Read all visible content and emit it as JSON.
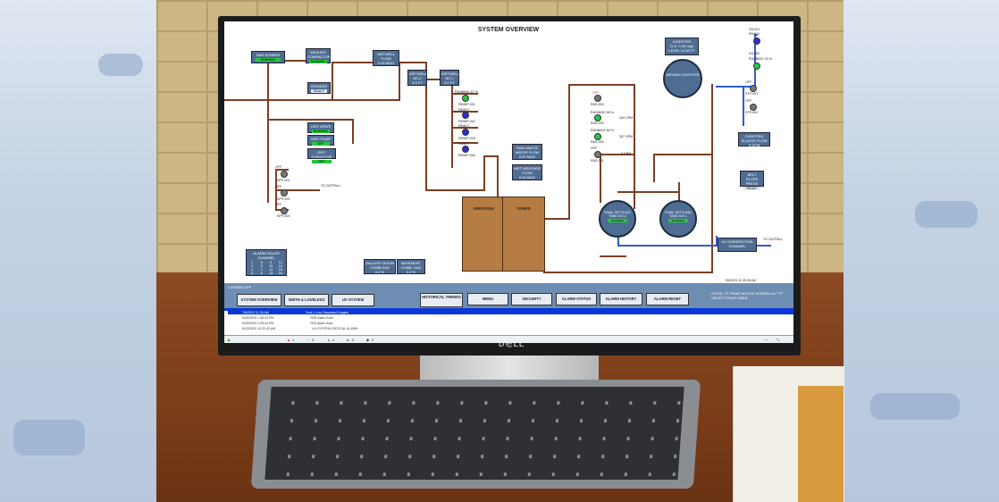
{
  "title": "SYSTEM OVERVIEW",
  "equipment": {
    "bar_screen": {
      "label": "BAR SCREEN",
      "status": "RUNNING"
    },
    "washer_compactor": {
      "label": "WASHER COMPACTOR",
      "status": "RUNNING"
    },
    "grinder": {
      "label": "GRINDER",
      "status": "READY"
    },
    "grit_drive": {
      "label": "GRIT DRIVE",
      "status": "RUNNING"
    },
    "grit_pump": {
      "label": "GRIT PUMP",
      "status": "OFF"
    },
    "grit_conveyor": {
      "label": "GRIT CONVEYOR",
      "status": "OFF"
    },
    "wetwell_flow": {
      "label": "WETWELL FLOW",
      "value": "0.45 MGD"
    },
    "wetwell_2": {
      "label": "WETWELL NO.2",
      "value": "4.3 FT"
    },
    "wetwell_1": {
      "label": "WETWELL NO.1",
      "value": "4.0 FT"
    },
    "raw_waste": {
      "label": "RAW WASTE WATER FLOW",
      "value": "0.57 MGD"
    },
    "wet_weather": {
      "label": "WET WEATHER FLOW",
      "value": "0.00 MGD"
    },
    "digester": {
      "label": "DIGESTER",
      "do": "D.O.   0.25 mg/l",
      "level": "LEVEL   14.56 FT"
    },
    "aerobic_digester": {
      "label": "AEROBIC DIGESTER"
    },
    "digested_sludge": {
      "label": "DIGESTED SLUDGE FLOW",
      "value": "0 GPM"
    },
    "belt_filter": {
      "label": "BELT FILTER PRESS",
      "status": "READY"
    },
    "uv": {
      "label": "UV DISINFECTION CHANNEL"
    },
    "fst2": {
      "label": "FINAL SETTLING TANK NO.2",
      "status": "RUNNING"
    },
    "fst1": {
      "label": "FINAL SETTLING TANK NO.1",
      "status": "RUNNING"
    },
    "gallery": {
      "label": "GALLERY ROOM COMB.GAS",
      "value": "0.2 %"
    },
    "basement": {
      "label": "BASEMENT COMB. GAS",
      "value": "0.2 %"
    },
    "aeration": {
      "label": "AERATION"
    },
    "tanks": {
      "label": "TANKS"
    }
  },
  "pumps": {
    "rwwp1": {
      "label": "RWWP-001",
      "status": "RUNNING 67 %"
    },
    "rwwp2": {
      "label": "RWWP-002",
      "status": "READY"
    },
    "rwwp3": {
      "label": "RWWP-003",
      "status": "READY"
    },
    "rwwp4": {
      "label": "RWWP-004",
      "status": "READY"
    },
    "ras3": {
      "label": "RAS-003",
      "status": "OFF"
    },
    "ras3b": {
      "label": "RAS-003",
      "status": "RUNNING 55 %",
      "flow": "344 GPM"
    },
    "ras2": {
      "label": "RAS-002",
      "status": "RUNNING 60 %",
      "flow": "357 GPM"
    },
    "ras1": {
      "label": "RAS-001",
      "status": "OFF",
      "flow": "0 GPM"
    },
    "ds1": {
      "label": "DS-001",
      "status": "READY"
    },
    "ds2": {
      "label": "DS-002",
      "status": "RUNNING 20 %"
    },
    "stp1": {
      "label": "STP-001",
      "status": "OFF"
    },
    "stp2": {
      "label": "STP-002",
      "status": "OFF"
    },
    "spp1": {
      "label": "SPP-001",
      "status": "OFF"
    },
    "spp2": {
      "label": "SPP-002",
      "status": "OFF"
    },
    "spp3": {
      "label": "SPP-003",
      "status": "OFF"
    }
  },
  "to_outfall": "TO OUTFALL",
  "alarm_dialer": {
    "label": "ALARM DIALER CHANNEL",
    "channels": [
      "1",
      "2",
      "3",
      "4",
      "5",
      "6",
      "7",
      "8",
      "9",
      "10",
      "11",
      "12",
      "13",
      "14",
      "15",
      "16"
    ]
  },
  "timestamp": "7/6/2023 11:35:28 AM",
  "nav": {
    "logged_off": "LOGGED OFF",
    "system_overview": "SYSTEM OVERVIEW",
    "smith_loveless": "SMITH & LOVELESS",
    "uv_system": "UV SYSTEM",
    "historical_trends": "HISTORICAL TRENDS",
    "menu": "MENU",
    "security": "SECURITY",
    "alarm_status": "ALARM STATUS",
    "alarm_history": "ALARM HISTORY",
    "alarm_reset": "ALARM RESET",
    "print_hint": "CNTRL \"P\" PRINT ACTIVE SCREEN ALT \"P\" SELECT PRINT AREA"
  },
  "alarms": [
    {
      "time": "7/6/2023 11:35 AM",
      "text": "Tank 1 Low Dissolved Oxygen"
    },
    {
      "time": "6/30/2023 1:36:43 PM",
      "text": "R2B Alarm Auto"
    },
    {
      "time": "6/30/2023 1:35:44 PM",
      "text": "R2A Alarm Auto"
    },
    {
      "time": "6/13/2023 10:22:43 AM",
      "text": "UV SYSTEM CRITICAL ALARM"
    }
  ],
  "status_counts": [
    "1",
    "3",
    "4",
    "0",
    "0"
  ],
  "colors": {
    "box": "#4f6d93",
    "running": "#27c63a",
    "pipe": "#7a3f24",
    "flow": "#2f5dcf",
    "nav": "#6e8db2"
  }
}
